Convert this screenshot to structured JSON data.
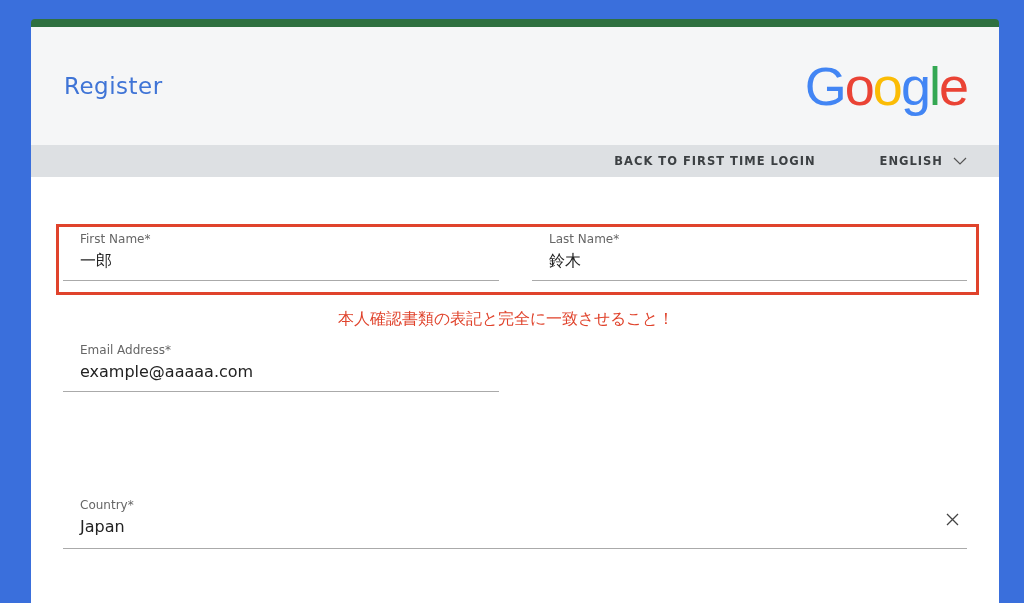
{
  "header": {
    "title": "Register",
    "logo": "Google"
  },
  "nav": {
    "links": [
      {
        "label": "BACK TO FIRST TIME LOGIN",
        "kind": "link"
      },
      {
        "label": "ENGLISH",
        "kind": "dropdown"
      }
    ]
  },
  "name_fields": [
    {
      "label": "First Name*",
      "value": "一郎"
    },
    {
      "label": "Last Name*",
      "value": "鈴木"
    }
  ],
  "annotation": "本人確認書類の表記と完全に一致させること！",
  "email": {
    "label": "Email Address*",
    "value": "example@aaaaa.com"
  },
  "country": {
    "label": "Country*",
    "value": "Japan"
  }
}
